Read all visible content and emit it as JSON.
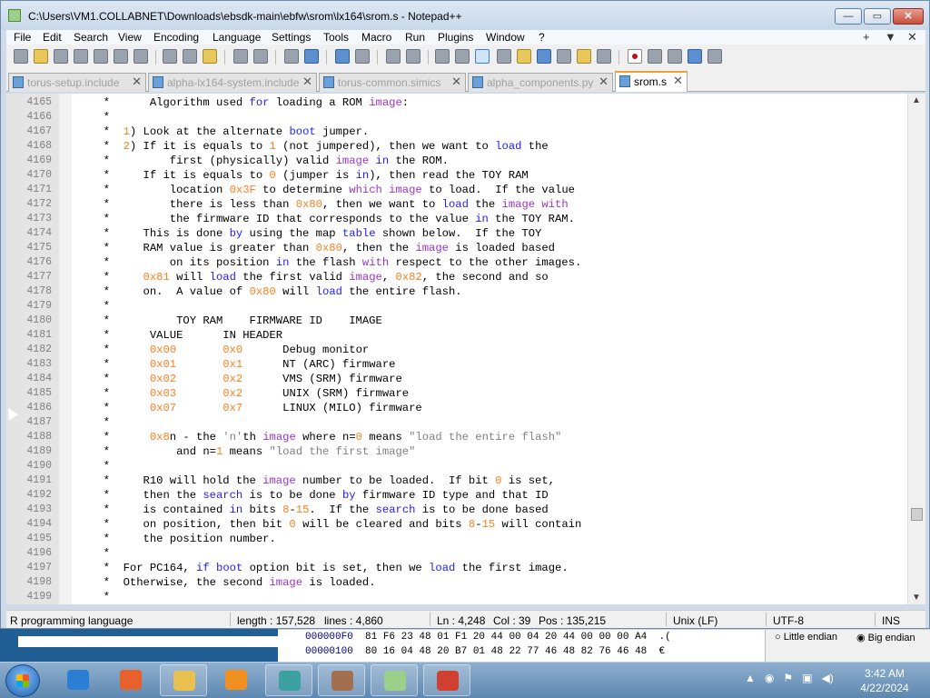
{
  "window": {
    "title": "C:\\Users\\VM1.COLLABNET\\Downloads\\ebsdk-main\\ebfw\\srom\\lx164\\srom.s - Notepad++",
    "min_glyph": "—",
    "max_glyph": "▭",
    "close_glyph": "✕"
  },
  "menu": {
    "items": [
      "File",
      "Edit",
      "Search",
      "View",
      "Encoding",
      "Language",
      "Settings",
      "Tools",
      "Macro",
      "Run",
      "Plugins",
      "Window",
      "?"
    ],
    "right": [
      "+",
      "▼",
      "✕"
    ]
  },
  "tabs": [
    {
      "label": "torus-setup.include",
      "active": false
    },
    {
      "label": "alpha-lx164-system.include",
      "active": false
    },
    {
      "label": "torus-common.simics",
      "active": false
    },
    {
      "label": "alpha_components.py",
      "active": false
    },
    {
      "label": "srom.s",
      "active": true
    }
  ],
  "tab_close_glyph": "✕",
  "editor": {
    "lines": [
      {
        "n": "4165",
        "t": "  *      Algorithm used <kw>for</kw> loading a ROM <kw2>image</kw2>:"
      },
      {
        "n": "4166",
        "t": "  *"
      },
      {
        "n": "4167",
        "t": "  *  <num>1</num>) Look at the alternate <kw>boot</kw> jumper."
      },
      {
        "n": "4168",
        "t": "  *  <num>2</num>) If it is equals to <num>1</num> (not jumpered), then we want to <kw>load</kw> the"
      },
      {
        "n": "4169",
        "t": "  *         first (physically) valid <kw2>image</kw2> <kw>in</kw> the ROM."
      },
      {
        "n": "4170",
        "t": "  *     If it is equals to <num>0</num> (jumper is <kw>in</kw>), then read the TOY RAM"
      },
      {
        "n": "4171",
        "t": "  *         location <num>0x3F</num> to determine <kw2>which</kw2> <kw2>image</kw2> to load.  If the value"
      },
      {
        "n": "4172",
        "t": "  *         there is less than <num>0x80</num>, then we want to <kw>load</kw> the <kw2>image</kw2> <kw2>with</kw2>"
      },
      {
        "n": "4173",
        "t": "  *         the firmware ID that corresponds to the value <kw>in</kw> the TOY RAM."
      },
      {
        "n": "4174",
        "t": "  *     This is done <kw>by</kw> using the map <kw>table</kw> shown below.  If the TOY"
      },
      {
        "n": "4175",
        "t": "  *     RAM value is greater than <num>0x80</num>, then the <kw2>image</kw2> is loaded based"
      },
      {
        "n": "4176",
        "t": "  *         on its position <kw>in</kw> the flash <kw2>with</kw2> respect to the other images."
      },
      {
        "n": "4177",
        "t": "  *     <num>0x81</num> will <kw>load</kw> the first valid <kw2>image</kw2>, <num>0x82</num>, the second and so"
      },
      {
        "n": "4178",
        "t": "  *     on.  A value of <num>0x80</num> will <kw>load</kw> the entire flash."
      },
      {
        "n": "4179",
        "t": "  *"
      },
      {
        "n": "4180",
        "t": "  *          TOY RAM    FIRMWARE ID    IMAGE"
      },
      {
        "n": "4181",
        "t": "  *      VALUE      IN HEADER"
      },
      {
        "n": "4182",
        "t": "  *      <num>0x00</num>       <num>0x0</num>      Debug monitor"
      },
      {
        "n": "4183",
        "t": "  *      <num>0x01</num>       <num>0x1</num>      NT (ARC) firmware"
      },
      {
        "n": "4184",
        "t": "  *      <num>0x02</num>       <num>0x2</num>      VMS (SRM) firmware"
      },
      {
        "n": "4185",
        "t": "  *      <num>0x03</num>       <num>0x2</num>      UNIX (SRM) firmware"
      },
      {
        "n": "4186",
        "t": "  *      <num>0x07</num>       <num>0x7</num>      LINUX (MILO) firmware"
      },
      {
        "n": "4187",
        "t": "  *"
      },
      {
        "n": "4188",
        "t": "  *      <num>0x8</num>n - the <str>'n'</str>th <kw2>image</kw2> where n=<num>0</num> means <str>\"load the entire flash\"</str>"
      },
      {
        "n": "4189",
        "t": "  *          and n=<num>1</num> means <str>\"load the first image\"</str>"
      },
      {
        "n": "4190",
        "t": "  *"
      },
      {
        "n": "4191",
        "t": "  *     R10 will hold the <kw2>image</kw2> number to be loaded.  If bit <num>0</num> is set,"
      },
      {
        "n": "4192",
        "t": "  *     then the <kw>search</kw> is to be done <kw>by</kw> firmware ID type and that ID"
      },
      {
        "n": "4193",
        "t": "  *     is contained <kw>in</kw> bits <num>8</num>-<num>15</num>.  If the <kw>search</kw> is to be done based"
      },
      {
        "n": "4194",
        "t": "  *     on position, then bit <num>0</num> will be cleared and bits <num>8</num>-<num>15</num> will contain"
      },
      {
        "n": "4195",
        "t": "  *     the position number."
      },
      {
        "n": "4196",
        "t": "  *"
      },
      {
        "n": "4197",
        "t": "  *  For PC164, <kw>if</kw> <kw>boot</kw> option bit is set, then we <kw>load</kw> the first image."
      },
      {
        "n": "4198",
        "t": "  *  Otherwise, the second <kw2>image</kw2> is loaded."
      },
      {
        "n": "4199",
        "t": "  *"
      }
    ]
  },
  "status": {
    "language": "R programming language",
    "length": "length : 157,528",
    "lines": "lines : 4,860",
    "ln": "Ln : 4,248",
    "col": "Col : 39",
    "pos": "Pos : 135,215",
    "eol": "Unix (LF)",
    "encoding": "UTF-8",
    "mode": "INS"
  },
  "background_window": {
    "row1_addr": "000000F0",
    "row1_bytes": "81 F6 23 48 01 F1 20 44 00 04 20 44 00 00 00 A4",
    "row1_ascii": ".(",
    "row2_addr": "00000100",
    "row2_bytes": "80 16 04 48 20 B7 01 48 22 77 46 48 82 76 46 48",
    "row2_ascii": "€",
    "opt_little": "Little endian",
    "opt_big": "Big endian"
  },
  "taskbar": {
    "time": "3:42 AM",
    "date": "4/22/2024",
    "apps": [
      {
        "name": "internet-explorer",
        "color": "#2a7fd4",
        "open": false
      },
      {
        "name": "firefox",
        "color": "#e8602c",
        "open": false
      },
      {
        "name": "file-explorer",
        "color": "#e8c050",
        "open": true
      },
      {
        "name": "media-player",
        "color": "#f09020",
        "open": false
      },
      {
        "name": "simics",
        "color": "#3aa0a0",
        "open": true
      },
      {
        "name": "app-swirl",
        "color": "#a07050",
        "open": true
      },
      {
        "name": "notepad-plus-plus",
        "color": "#9ad08a",
        "open": true
      },
      {
        "name": "hxd-hex-editor",
        "color": "#d04030",
        "open": true
      }
    ]
  }
}
